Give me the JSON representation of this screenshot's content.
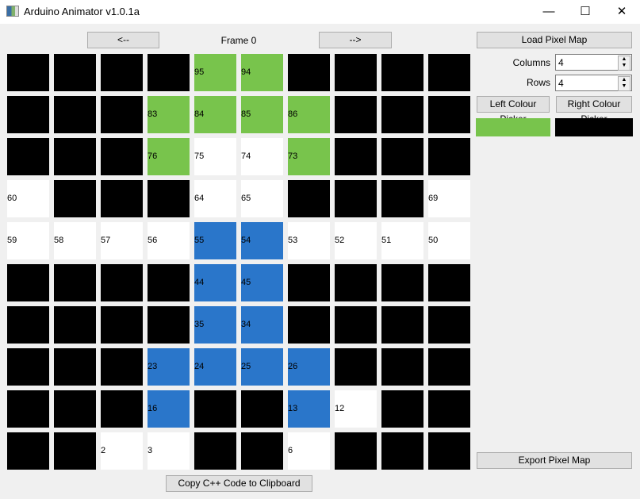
{
  "window": {
    "title": "Arduino Animator v1.0.1a",
    "minimize": "—",
    "maximize": "☐",
    "close": "✕"
  },
  "nav": {
    "prev": "<--",
    "frame_label": "Frame 0",
    "next": "-->"
  },
  "side": {
    "load": "Load Pixel Map",
    "columns_label": "Columns",
    "columns_value": "4",
    "rows_label": "Rows",
    "rows_value": "4",
    "left_picker": "Left Colour Picker",
    "right_picker": "Right Colour Picker",
    "left_colour": "#78c44c",
    "right_colour": "#000000",
    "export": "Export Pixel Map"
  },
  "copy_button": "Copy C++ Code to Clipboard",
  "palette": {
    "B": "#000000",
    "G": "#78c44c",
    "W": "#ffffff",
    "L": "#2a76ca"
  },
  "grid": [
    [
      [
        "B",
        ""
      ],
      [
        "B",
        ""
      ],
      [
        "B",
        ""
      ],
      [
        "B",
        ""
      ],
      [
        "G",
        "95"
      ],
      [
        "G",
        "94"
      ],
      [
        "B",
        ""
      ],
      [
        "B",
        ""
      ],
      [
        "B",
        ""
      ],
      [
        "B",
        ""
      ]
    ],
    [
      [
        "B",
        ""
      ],
      [
        "B",
        ""
      ],
      [
        "B",
        ""
      ],
      [
        "G",
        "83"
      ],
      [
        "G",
        "84"
      ],
      [
        "G",
        "85"
      ],
      [
        "G",
        "86"
      ],
      [
        "B",
        ""
      ],
      [
        "B",
        ""
      ],
      [
        "B",
        ""
      ]
    ],
    [
      [
        "B",
        ""
      ],
      [
        "B",
        ""
      ],
      [
        "B",
        ""
      ],
      [
        "G",
        "76"
      ],
      [
        "W",
        "75"
      ],
      [
        "W",
        "74"
      ],
      [
        "G",
        "73"
      ],
      [
        "B",
        ""
      ],
      [
        "B",
        ""
      ],
      [
        "B",
        ""
      ]
    ],
    [
      [
        "W",
        "60"
      ],
      [
        "B",
        ""
      ],
      [
        "B",
        ""
      ],
      [
        "B",
        ""
      ],
      [
        "W",
        "64"
      ],
      [
        "W",
        "65"
      ],
      [
        "B",
        ""
      ],
      [
        "B",
        ""
      ],
      [
        "B",
        ""
      ],
      [
        "W",
        "69"
      ]
    ],
    [
      [
        "W",
        "59"
      ],
      [
        "W",
        "58"
      ],
      [
        "W",
        "57"
      ],
      [
        "W",
        "56"
      ],
      [
        "L",
        "55"
      ],
      [
        "L",
        "54"
      ],
      [
        "W",
        "53"
      ],
      [
        "W",
        "52"
      ],
      [
        "W",
        "51"
      ],
      [
        "W",
        "50"
      ]
    ],
    [
      [
        "B",
        ""
      ],
      [
        "B",
        ""
      ],
      [
        "B",
        ""
      ],
      [
        "B",
        ""
      ],
      [
        "L",
        "44"
      ],
      [
        "L",
        "45"
      ],
      [
        "B",
        ""
      ],
      [
        "B",
        ""
      ],
      [
        "B",
        ""
      ],
      [
        "B",
        ""
      ]
    ],
    [
      [
        "B",
        ""
      ],
      [
        "B",
        ""
      ],
      [
        "B",
        ""
      ],
      [
        "B",
        ""
      ],
      [
        "L",
        "35"
      ],
      [
        "L",
        "34"
      ],
      [
        "B",
        ""
      ],
      [
        "B",
        ""
      ],
      [
        "B",
        ""
      ],
      [
        "B",
        ""
      ]
    ],
    [
      [
        "B",
        ""
      ],
      [
        "B",
        ""
      ],
      [
        "B",
        ""
      ],
      [
        "L",
        "23"
      ],
      [
        "L",
        "24"
      ],
      [
        "L",
        "25"
      ],
      [
        "L",
        "26"
      ],
      [
        "B",
        ""
      ],
      [
        "B",
        ""
      ],
      [
        "B",
        ""
      ]
    ],
    [
      [
        "B",
        ""
      ],
      [
        "B",
        ""
      ],
      [
        "B",
        ""
      ],
      [
        "L",
        "16"
      ],
      [
        "B",
        ""
      ],
      [
        "B",
        ""
      ],
      [
        "L",
        "13"
      ],
      [
        "W",
        "12"
      ],
      [
        "B",
        ""
      ],
      [
        "B",
        ""
      ]
    ],
    [
      [
        "B",
        ""
      ],
      [
        "B",
        ""
      ],
      [
        "W",
        "2"
      ],
      [
        "W",
        "3"
      ],
      [
        "B",
        ""
      ],
      [
        "B",
        ""
      ],
      [
        "W",
        "6"
      ],
      [
        "B",
        ""
      ],
      [
        "B",
        ""
      ],
      [
        "B",
        ""
      ]
    ]
  ]
}
